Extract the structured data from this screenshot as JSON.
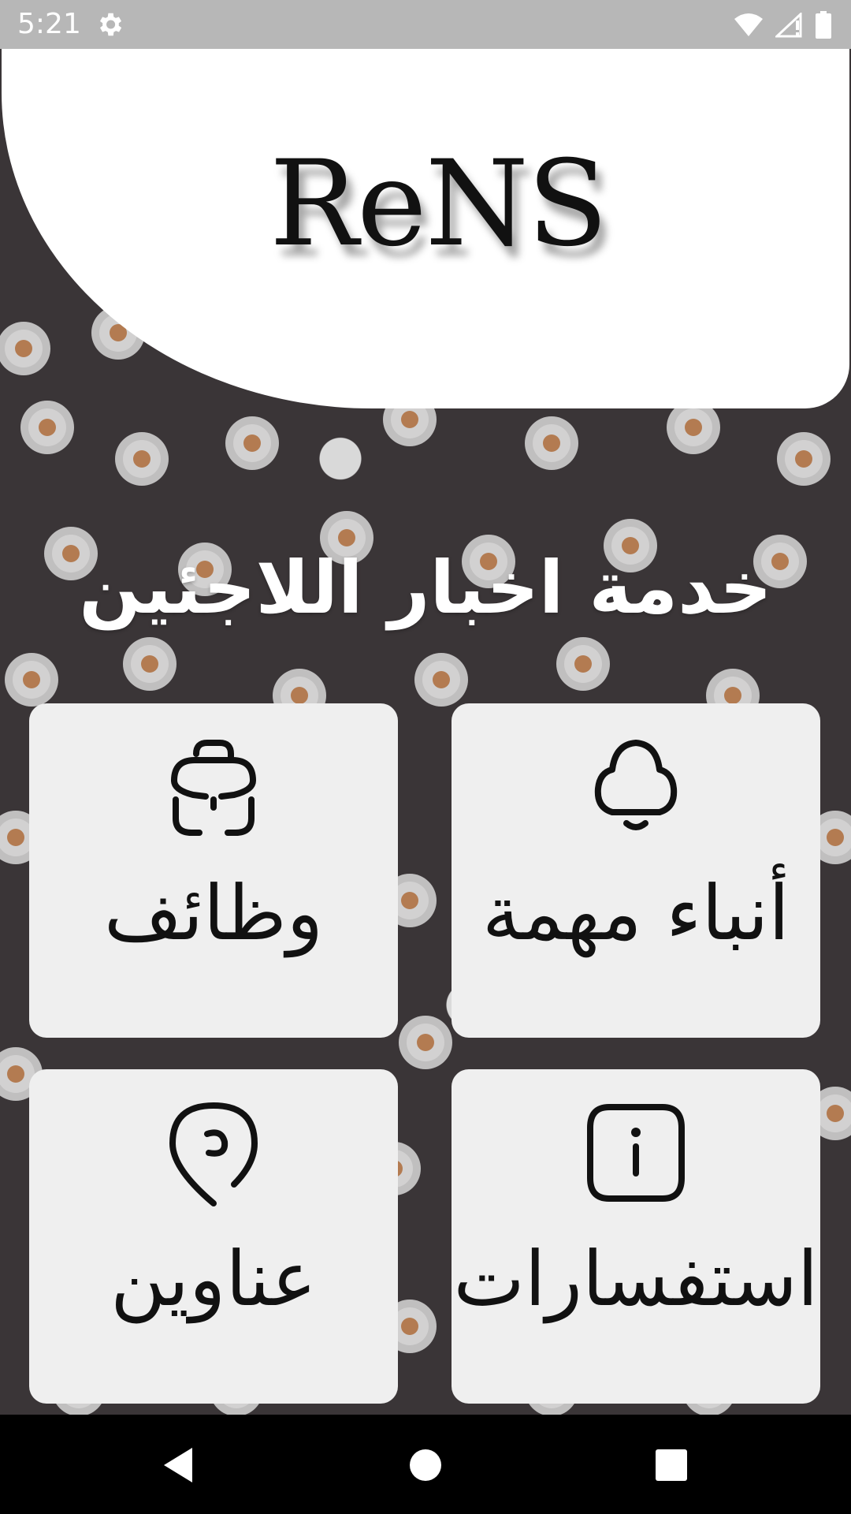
{
  "status_bar": {
    "time": "5:21",
    "icons": [
      "gear-icon",
      "wifi-icon",
      "signal-icon",
      "battery-icon"
    ]
  },
  "header": {
    "logo": "ReNS"
  },
  "main": {
    "title": "خدمة اخبار اللاجئين",
    "tiles": [
      {
        "label": "وظائف",
        "icon": "briefcase-icon"
      },
      {
        "label": "أنباء مهمة",
        "icon": "bell-icon"
      },
      {
        "label": "عناوين",
        "icon": "location-pin-icon"
      },
      {
        "label": "استفسارات",
        "icon": "info-icon"
      }
    ]
  },
  "nav_bar": {
    "icons": [
      "back-icon",
      "home-icon",
      "recents-icon"
    ]
  },
  "colors": {
    "tile_bg": "#efefef",
    "status_bar": "#b7b7b7",
    "text_dark": "#111111"
  }
}
